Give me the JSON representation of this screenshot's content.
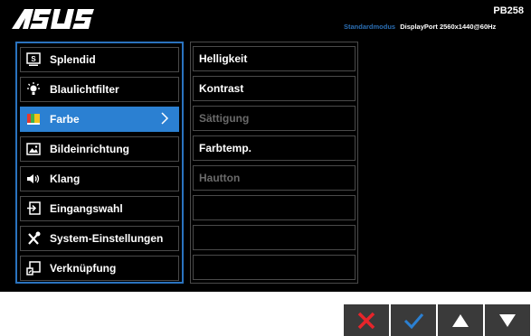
{
  "brand": {
    "logo_text": "/ISUS"
  },
  "model": "PB258",
  "status": {
    "mode": "Standardmodus",
    "info": "DisplayPort 2560x1440@60Hz"
  },
  "menu": {
    "items": [
      {
        "label": "Splendid",
        "icon": "splendid-icon"
      },
      {
        "label": "Blaulichtfilter",
        "icon": "blue-light-icon"
      },
      {
        "label": "Farbe",
        "icon": "color-icon",
        "active": true
      },
      {
        "label": "Bildeinrichtung",
        "icon": "image-icon"
      },
      {
        "label": "Klang",
        "icon": "speaker-icon"
      },
      {
        "label": "Eingangswahl",
        "icon": "input-icon"
      },
      {
        "label": "System-Einstellungen",
        "icon": "wrench-icon"
      },
      {
        "label": "Verknüpfung",
        "icon": "shortcut-icon"
      }
    ]
  },
  "submenu": {
    "items": [
      {
        "label": "Helligkeit",
        "enabled": true
      },
      {
        "label": "Kontrast",
        "enabled": true
      },
      {
        "label": "Sättigung",
        "enabled": false
      },
      {
        "label": "Farbtemp.",
        "enabled": true
      },
      {
        "label": "Hautton",
        "enabled": false
      },
      {
        "label": ""
      },
      {
        "label": ""
      },
      {
        "label": ""
      }
    ]
  },
  "navigation": {
    "buttons": [
      {
        "icon": "close-icon",
        "color": "#e8242a"
      },
      {
        "icon": "check-icon",
        "color": "#2b80d2"
      },
      {
        "icon": "arrow-up-icon",
        "color": "#ffffff"
      },
      {
        "icon": "arrow-down-icon",
        "color": "#ffffff"
      }
    ]
  },
  "colors": {
    "accent": "#2b80d2",
    "frame": "#2a73bf"
  }
}
